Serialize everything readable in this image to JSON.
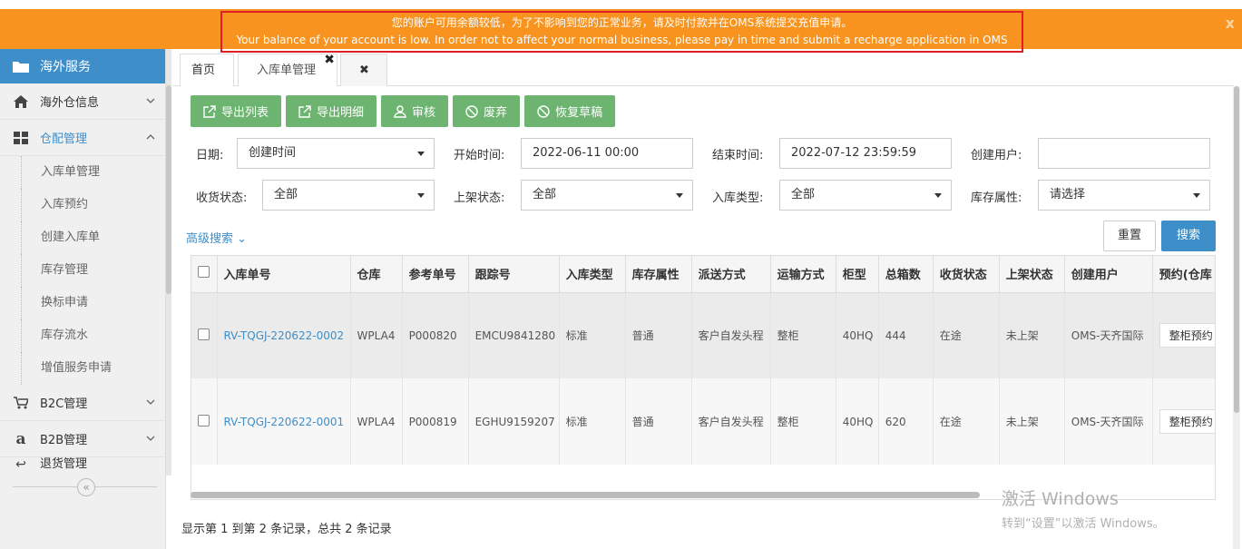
{
  "banner": {
    "line_cn": "您的账户可用余额较低，为了不影响到您的正常业务，请及时付款并在OMS系统提交充值申请。",
    "line_en": "Your balance of your account is low. In order not to affect your normal business, please pay in time and submit a recharge application in OMS system.",
    "close": "x"
  },
  "sidebar": {
    "header": "海外服务",
    "items": [
      {
        "label": "海外仓信息",
        "icon": "home-icon"
      },
      {
        "label": "仓配管理",
        "icon": "grid-icon"
      },
      {
        "label": "B2C管理",
        "icon": "cart-icon"
      },
      {
        "label": "B2B管理",
        "icon": "amazon-icon"
      },
      {
        "label": "退货管理",
        "icon": "return-icon"
      }
    ],
    "subitems": [
      "入库单管理",
      "入库预约",
      "创建入库单",
      "库存管理",
      "换标申请",
      "库存流水",
      "增值服务申请"
    ],
    "collapse": "«"
  },
  "tabs": {
    "home": "首页",
    "current": "入库单管理",
    "close_glyph": "✖"
  },
  "toolbar": {
    "export_list": "导出列表",
    "export_detail": "导出明细",
    "review": "审核",
    "discard": "废弃",
    "restore_draft": "恢复草稿"
  },
  "filters": {
    "date_label": "日期:",
    "date_value": "创建时间",
    "start_label": "开始时间:",
    "start_value": "2022-06-11 00:00",
    "end_label": "结束时间:",
    "end_value": "2022-07-12 23:59:59",
    "user_label": "创建用户:",
    "user_value": "",
    "receive_label": "收货状态:",
    "receive_value": "全部",
    "shelf_label": "上架状态:",
    "shelf_value": "全部",
    "type_label": "入库类型:",
    "type_value": "全部",
    "attr_label": "库存属性:",
    "attr_value": "请选择",
    "advanced": "高级搜索 ⌄",
    "reset": "重置",
    "search": "搜索"
  },
  "table": {
    "headers": [
      "入库单号",
      "仓库",
      "参考单号",
      "跟踪号",
      "入库类型",
      "库存属性",
      "派送方式",
      "运输方式",
      "柜型",
      "总箱数",
      "收货状态",
      "上架状态",
      "创建用户",
      "预约(仓库"
    ],
    "rows": [
      {
        "id": "RV-TQGJ-220622-0002",
        "wh": "WPLA4",
        "ref": "P000820",
        "track": "EMCU9841280",
        "type": "标准",
        "attr": "普通",
        "delivery": "客户自发头程",
        "transport": "整柜",
        "container": "40HQ",
        "boxes": "444",
        "receive": "在途",
        "shelf": "未上架",
        "user": "OMS-天齐国际",
        "booking": "整柜预约"
      },
      {
        "id": "RV-TQGJ-220622-0001",
        "wh": "WPLA4",
        "ref": "P000819",
        "track": "EGHU9159207",
        "type": "标准",
        "attr": "普通",
        "delivery": "客户自发头程",
        "transport": "整柜",
        "container": "40HQ",
        "boxes": "620",
        "receive": "在途",
        "shelf": "未上架",
        "user": "OMS-天齐国际",
        "booking": "整柜预约"
      }
    ]
  },
  "pager": "显示第 1 到第 2 条记录，总共 2 条记录",
  "watermark": {
    "line1": "激活 Windows",
    "line2": "转到“设置”以激活 Windows。"
  }
}
